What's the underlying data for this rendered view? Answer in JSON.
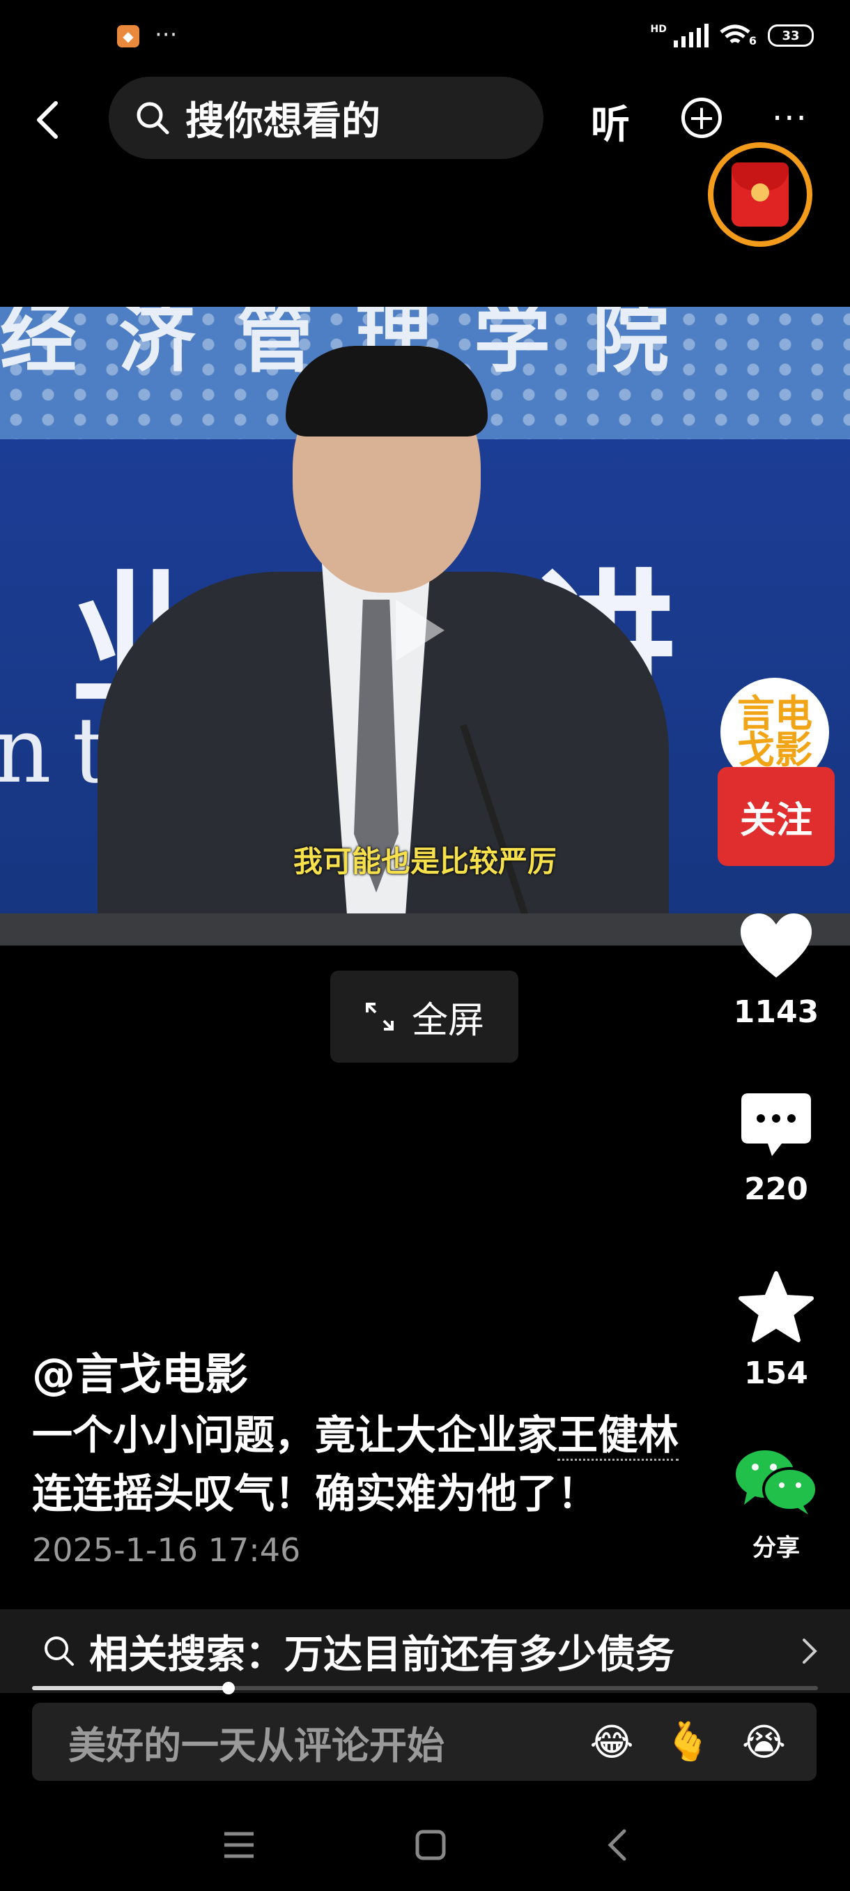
{
  "status_bar": {
    "dots": "···",
    "network": "HD",
    "network_sub": "6",
    "battery": "33"
  },
  "header": {
    "search_placeholder": "搜你想看的",
    "listen_label": "听",
    "plus_label": "+",
    "more_label": "···"
  },
  "video": {
    "banner_top_text": "经济管理学院",
    "banner_main_text": "业界讲",
    "banner_en_text": "nt F      Lec",
    "subtitle": "我可能也是比较严厉"
  },
  "fullscreen_label": "全屏",
  "rail": {
    "avatar_text": "言电戈影",
    "follow_label": "关注",
    "like_count": "1143",
    "comment_count": "220",
    "favorite_count": "154",
    "share_label": "分享"
  },
  "post": {
    "author": "@言戈电影",
    "caption_part1": "一个小小问题，竟让大企业家",
    "caption_link": "王健林",
    "caption_part2": "连连摇头叹气！确实难为他了！",
    "time": "2025-1-16 17:46"
  },
  "related_search": "相关搜索：万达目前还有多少债务",
  "progress": 0.25,
  "comment": {
    "placeholder": "美好的一天从评论开始",
    "emojis": [
      "😂",
      "🫰",
      "😭"
    ]
  }
}
